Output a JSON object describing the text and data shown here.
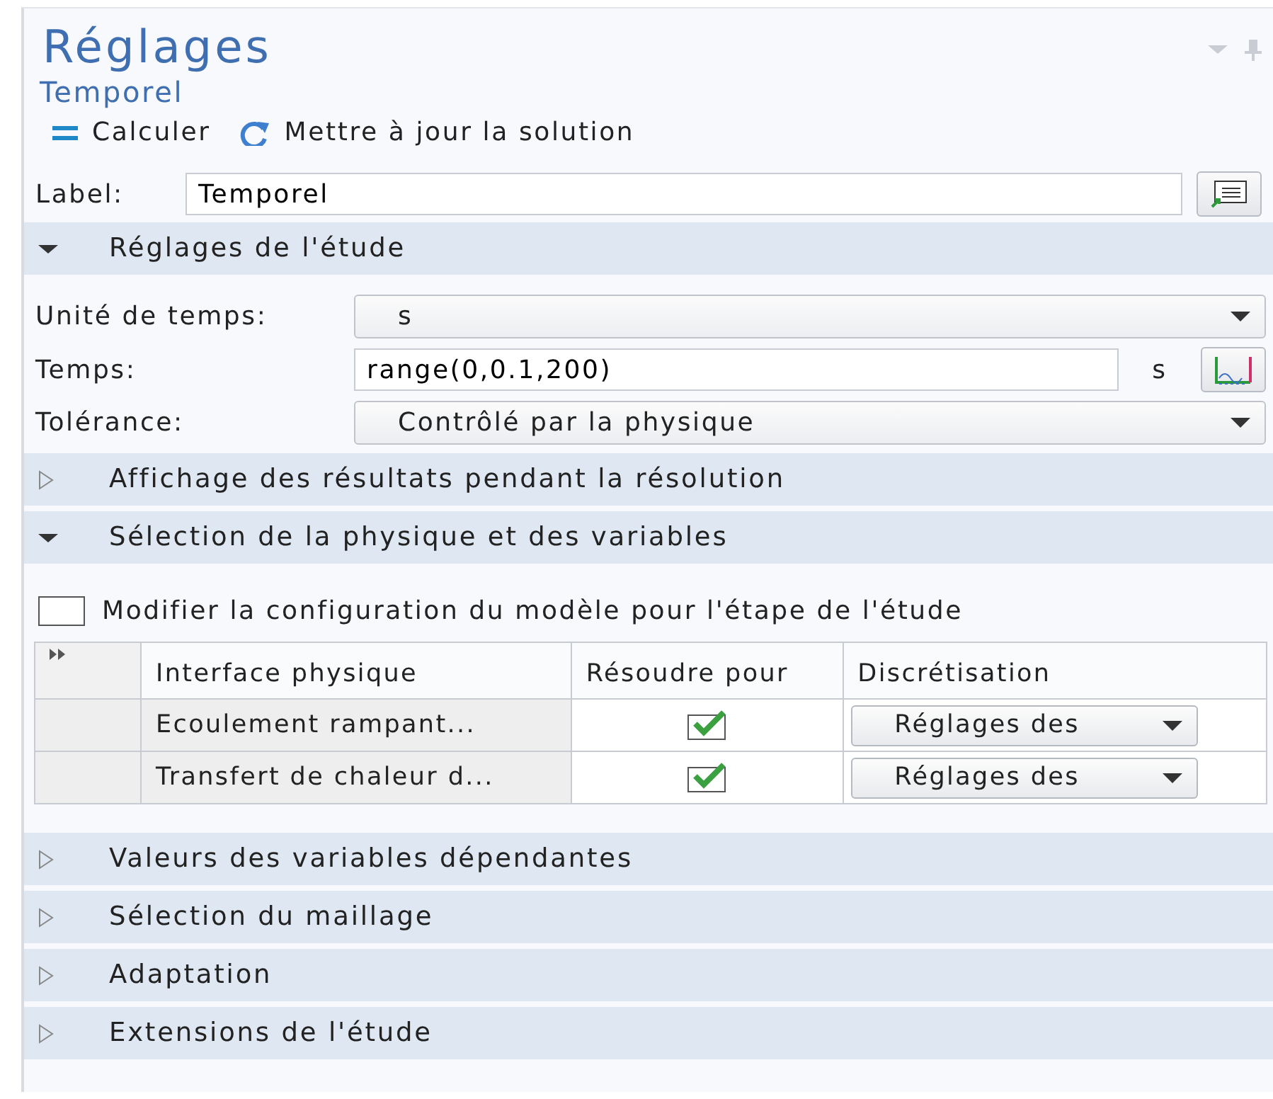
{
  "panel": {
    "title": "Réglages",
    "subtitle": "Temporel"
  },
  "toolbar": [
    {
      "kind": "compute",
      "label": "Calculer"
    },
    {
      "kind": "update",
      "label": "Mettre à jour la solution"
    }
  ],
  "label_field": {
    "label": "Label:",
    "value": "Temporel"
  },
  "sections": [
    {
      "title": "Réglages de l'étude",
      "expanded": true,
      "kind": "fields",
      "fields": [
        {
          "kind": "select",
          "label": "Unité de temps:",
          "value": "s"
        },
        {
          "kind": "input",
          "label": "Temps:",
          "value": "range(0,0.1,200)",
          "unit": "s"
        },
        {
          "kind": "select",
          "label": "Tolérance:",
          "value": "Contrôlé par la physique"
        }
      ]
    },
    {
      "title": "Affichage des résultats pendant la résolution",
      "expanded": false
    },
    {
      "title": "Sélection de la physique et des variables",
      "expanded": true,
      "kind": "physics",
      "checkbox": {
        "label": "Modifier la configuration du modèle pour l'étape de l'étude",
        "checked": false
      },
      "table": {
        "columns": [
          "Interface physique",
          "Résoudre pour",
          "Discrétisation"
        ],
        "rows": [
          {
            "interface": "Ecoulement rampant...",
            "solve": true,
            "discretization": "Réglages des"
          },
          {
            "interface": "Transfert de chaleur d...",
            "solve": true,
            "discretization": "Réglages des"
          }
        ]
      }
    },
    {
      "title": "Valeurs des variables dépendantes",
      "expanded": false
    },
    {
      "title": "Sélection du maillage",
      "expanded": false
    },
    {
      "title": "Adaptation",
      "expanded": false
    },
    {
      "title": "Extensions de l'étude",
      "expanded": false
    }
  ]
}
